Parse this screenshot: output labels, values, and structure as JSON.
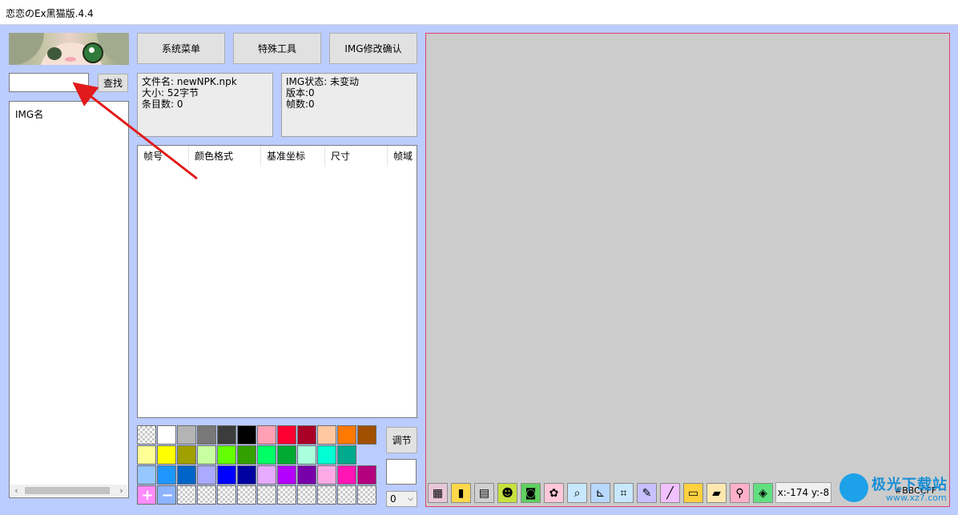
{
  "window": {
    "title": "恋恋のEx黑猫版.4.4"
  },
  "toolbar": {
    "system_menu": "系统菜单",
    "special_tools": "特殊工具",
    "img_confirm": "IMG修改确认"
  },
  "search": {
    "value": "",
    "button": "查找"
  },
  "file_info": {
    "filename": "文件名: newNPK.npk",
    "size": "大小: 52字节",
    "entries": "条目数: 0"
  },
  "img_info": {
    "status": "IMG状态: 未变动",
    "version": "版本:0",
    "frames": "帧数:0"
  },
  "img_list": {
    "header": "IMG名"
  },
  "frame_list": {
    "columns": [
      "帧号",
      "颜色格式",
      "基准坐标",
      "尺寸",
      "帧域"
    ]
  },
  "palette": {
    "adjust_button": "调节",
    "select_value": "0",
    "current_color": "#ffffff",
    "rows": [
      [
        "transparent",
        "#ffffff",
        "#b4b4b4",
        "#787878",
        "#3c3c3c",
        "#000000",
        "#ffa0b4",
        "#ff0032",
        "#aa0028",
        "#ffc8a0",
        "#ff7800",
        "#a05000"
      ],
      [
        "#ffff96",
        "#ffff00",
        "#a0a000",
        "#c8ffa0",
        "#64ff00",
        "#32a000",
        "#00ff64",
        "#00aa32",
        "#aaffdc",
        "#00ffd2",
        "#00aa8c"
      ],
      [
        "#96c8ff",
        "#1e96ff",
        "#0064c8",
        "#aaaaff",
        "#0000ff",
        "#0000a0",
        "#e6aaff",
        "#b400ff",
        "#7800aa",
        "#ffaae6",
        "#ff14b4",
        "#b4007f"
      ]
    ],
    "tools": {
      "add": "+",
      "remove": "−",
      "add_color": "#ff8cff",
      "remove_color": "#8cb4ff"
    }
  },
  "canvas": {
    "background": "#cccccc",
    "border": "#e0406a"
  },
  "statusbar": {
    "coords": "x:-174 y:-8",
    "color_hex": "#BBCCFF"
  },
  "bottom_tools": [
    {
      "icon": "grid-image-icon",
      "glyph": "▦",
      "bg": "#e8c8d8"
    },
    {
      "icon": "palette-bars-icon",
      "glyph": "▮",
      "bg": "#ffd84a"
    },
    {
      "icon": "film-icon",
      "glyph": "▤",
      "bg": "#d0d0d0"
    },
    {
      "icon": "cat-icon",
      "glyph": "☻",
      "bg": "#c8e040"
    },
    {
      "icon": "camera-icon",
      "glyph": "◙",
      "bg": "#60d060"
    },
    {
      "icon": "paw-icon",
      "glyph": "✿",
      "bg": "#ffc8d8"
    },
    {
      "icon": "magnifier-icon",
      "glyph": "⌕",
      "bg": "#c8e8ff"
    },
    {
      "icon": "axis-icon",
      "glyph": "⊾",
      "bg": "#b8d8ff"
    },
    {
      "icon": "crop-icon",
      "glyph": "⌗",
      "bg": "#c8e8ff"
    },
    {
      "icon": "pencil-icon",
      "glyph": "✎",
      "bg": "#c8c0ff"
    },
    {
      "icon": "line-icon",
      "glyph": "╱",
      "bg": "#f0c0ff"
    },
    {
      "icon": "rectangle-icon",
      "glyph": "▭",
      "bg": "#ffd040"
    },
    {
      "icon": "eraser-icon",
      "glyph": "▰",
      "bg": "#ffe8b0"
    },
    {
      "icon": "eyedropper-icon",
      "glyph": "⚲",
      "bg": "#ffb0c8"
    },
    {
      "icon": "tag-icon",
      "glyph": "◈",
      "bg": "#60e080"
    }
  ],
  "watermark": {
    "brand": "极光下载站",
    "domain": "www.xz7.com"
  }
}
